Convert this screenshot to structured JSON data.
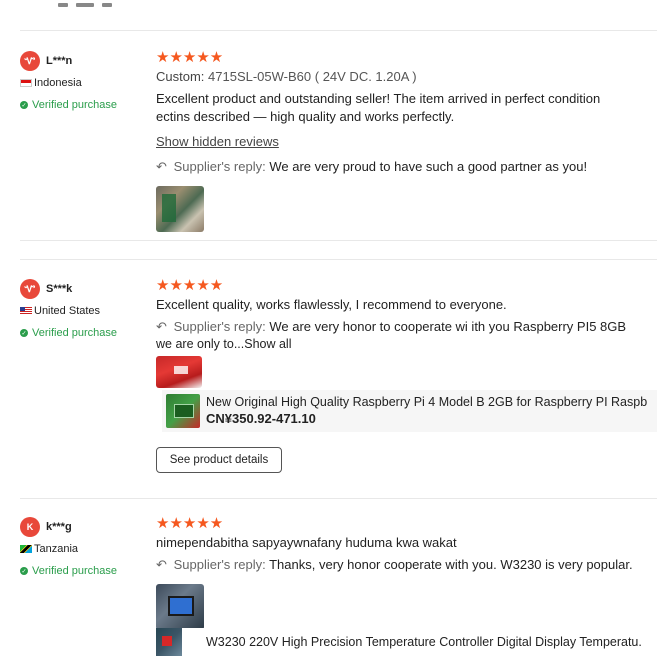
{
  "reviews": [
    {
      "avatar_letter": "Ꮙ",
      "username": "L***n",
      "country": "Indonesia",
      "verified": "Verified purchase",
      "stars": "★★★★★",
      "custom_label": "Custom:",
      "custom_value": "4715SL-05W-B60 ( 24V DC. 1.20A )",
      "text_lines": [
        "Excellent product and outstanding seller! The item arrived in perfect condition",
        "ectins described — high quality and works perfectly."
      ],
      "show_hidden": "Show hidden reviews",
      "reply_label": "Supplier's reply:",
      "reply_text": "We are very proud to have such a good partner as you!"
    },
    {
      "avatar_letter": "Ꮙ",
      "username": "S***k",
      "country": "United States",
      "verified": "Verified purchase",
      "stars": "★★★★★",
      "text_lines": [
        "Excellent quality, works flawlessly, I recommend to everyone."
      ],
      "reply_label": "Supplier's reply:",
      "reply_text": "We are very honor to cooperate wi ith you Raspberry PI5 8GB",
      "reply_continuation": "we are only to...Show all",
      "product_title": "New Original High Quality Raspberry Pi 4 Model B 2GB for Raspberry PI Raspb",
      "product_price": "CN¥350.92-471.10",
      "see_details": "See product details"
    },
    {
      "avatar_letter": "K",
      "username": "k***g",
      "country": "Tanzania",
      "verified": "Verified purchase",
      "stars": "★★★★★",
      "text_lines": [
        "nimependabitha sapyaywnafany huduma kwa wakat"
      ],
      "reply_label": "Supplier's reply:",
      "reply_text": "Thanks, very honor cooperate with you. W3230 is very popular.",
      "product_title": "W3230 220V High Precision Temperature Controller Digital Display Temperatu."
    }
  ],
  "icons": {
    "reply": "reply-arrow-icon",
    "verified": "check-circle-icon",
    "rating": "star-icon"
  },
  "colors": {
    "star": "#f5581f",
    "verified": "#2a9d4b",
    "avatar": "#e8483a"
  }
}
